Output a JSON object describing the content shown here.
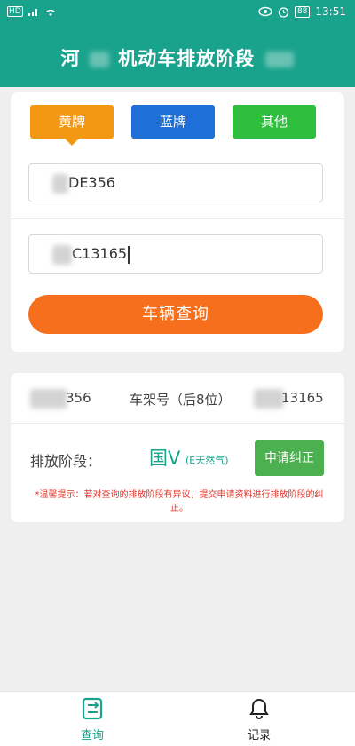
{
  "status_bar": {
    "left_label": "HD",
    "battery": "88",
    "time": "13:51"
  },
  "header": {
    "title_part1": "河",
    "title_part2": "机动车排放阶段"
  },
  "plate_types": [
    {
      "label": "黄牌",
      "color": "#f39813"
    },
    {
      "label": "蓝牌",
      "color": "#1f6fd8"
    },
    {
      "label": "其他",
      "color": "#2fbe3e"
    }
  ],
  "form": {
    "plate_value": "DE356",
    "vin_value": "C13165",
    "query_label": "车辆查询"
  },
  "result": {
    "plate_tail": "356",
    "vin_label": "车架号（后8位）",
    "vin_tail": "13165",
    "emission_label": "排放阶段：",
    "emission_value": "国V",
    "emission_sub": "(E天然气)",
    "correct_label": "申请纠正",
    "tip": "*温馨提示：若对查询的排放阶段有异议，提交申请资料进行排放阶段的纠正。"
  },
  "tabs": [
    {
      "label": "查询",
      "icon": "query-icon",
      "active": true,
      "color": "#1aa38c"
    },
    {
      "label": "记录",
      "icon": "bell-icon",
      "active": false,
      "color": "#222222"
    }
  ],
  "colors": {
    "primary": "#1aa38c",
    "orange": "#f56f1c",
    "green": "#4caf50"
  }
}
